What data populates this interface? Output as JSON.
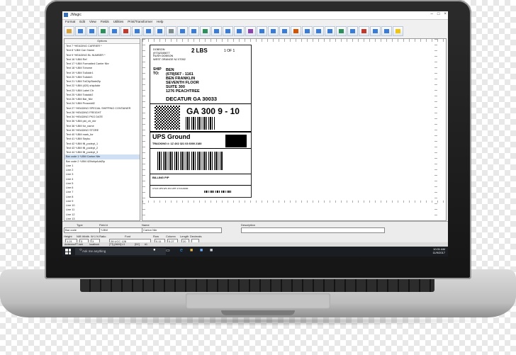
{
  "window": {
    "title": "JMagic"
  },
  "menu": [
    "Format",
    "Edit",
    "View",
    "Fields",
    "Utilities",
    "Print/Transformer",
    "Help"
  ],
  "toolbar": {
    "colors": [
      "#d8a23a",
      "#3a7bd5",
      "#3a7bd5",
      "#2f8f5b",
      "#3a7bd5",
      "#c0392b",
      "#3a7bd5",
      "#3a7bd5",
      "#3a7bd5",
      "#7f8c8d",
      "#3a7bd5",
      "#3a7bd5",
      "#2f8f5b",
      "#3a7bd5",
      "#3a7bd5",
      "#3a7bd5",
      "#8e44ad",
      "#3a7bd5",
      "#3a7bd5",
      "#3a7bd5",
      "#d35400",
      "#3a7bd5",
      "#3a7bd5",
      "#3a7bd5",
      "#2f8f5b",
      "#3a7bd5",
      "#c0392b",
      "#3a7bd5",
      "#3a7bd5",
      "#f1c40f"
    ]
  },
  "left_panel": {
    "header": "Options",
    "items": [
      "Text 7 *HEADING CARRIER *",
      "Text 8 *LBM Carr Name",
      "Text 9 *HEADING BL NUMBER *",
      "Text 16 *LBM Ref",
      "Text 17 *LBM Formatted Carrier Nbr",
      "Text 18 *LBM Tohome",
      "Text 19 *LBM TolAddr1",
      "Text 20 *LBM ToAddr1",
      "Text 21 *LBM TolCityStateZip",
      "Text 22 *LBM (420) shipAddr",
      "Text 23 *LBM Label Ctr",
      "Text 25 *LBM Totaddr2",
      "Text 26 *LBM Bar_Nbr",
      "Text 24 *LBM Proseddl2",
      "Text 27 *HEADING SPECIAL SHIPPING CONTAINER",
      "Text 28 *HEADING FREIGHT",
      "Text 34 *HEADING PKG DATE",
      "Text 36 *LBM pkt_ctr_nbr",
      "Text 38 *LBM for_name",
      "Text 39 *HEADING STORE",
      "Text 40 *LBM mark_for",
      "Text 41 *LBM Sepku",
      "Text 42 *LBM fill_podept_1",
      "Text 43 *LBM fill_podept_2",
      "Text 44 *LBM fill_podept_3",
      "Bar code 1 *LBM Carton Nbr",
      "Bar code 2 *LBM 420shipAddZip",
      "Line 1",
      "Line 2",
      "Line 3",
      "Line 4",
      "Line 5",
      "Line 6",
      "Line 7",
      "Line 8",
      "Line 9",
      "Line 10",
      "Line 11",
      "Line 12",
      "Line 13"
    ],
    "selected_index": 25
  },
  "shipping_label": {
    "from_lines": [
      "DOBSON",
      "(973)2345677",
      "RUSH DOBSON",
      "WEST ORANGE  NJ 07052"
    ],
    "weight": "2 LBS",
    "page": "1 OF 1",
    "ship_to_label": "SHIP\nTO:",
    "to_lines": [
      "BEN",
      "(678)567 - 1161",
      "BEN FRANKLIN",
      "SEVENTH FLOOR",
      "SUITE 300",
      "1276 PEACHTREE",
      "DECATUR GA 30033"
    ],
    "route": "GA 300 9 - 10",
    "service": "UPS Ground",
    "tracking": "TRACKING #: 1Z 4X2 321 03 6000 2180",
    "billing": "BILLING P/P",
    "footer": "CTLR  UPS WS 15.0 ZPT 4.5 01/2000"
  },
  "props": {
    "headers": [
      "Type",
      "Field #",
      "Name",
      "Description"
    ],
    "values": [
      "Bar code",
      "*LBM",
      "Carton Nbr",
      ""
    ],
    "labels2": [
      "Height",
      "N/B Width",
      "W:1 N Ratio",
      "Font",
      "Row",
      "Column",
      "Length",
      "Decimals"
    ],
    "values2": [
      "1.21",
      "3",
      "3",
      "28 UCC 128",
      "0.11",
      "0.27",
      "20",
      ""
    ]
  },
  "status": [
    "ArdenessFT-Iabt",
    "localhost",
    "[TT]-[9600]1.3",
    "[DC]",
    "#1"
  ],
  "taskbar": {
    "search": "Ask me anything",
    "time": "10:31 AM",
    "date": "11/9/2017"
  }
}
